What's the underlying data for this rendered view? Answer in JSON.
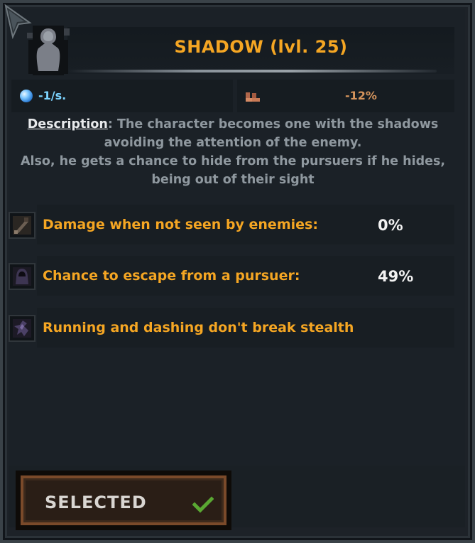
{
  "skill": {
    "title": "SHADOW (lvl. 25)",
    "icon": "shadow-figure-icon"
  },
  "stats": {
    "mana_cost": "-1/s.",
    "mana_icon": "mana-orb-icon",
    "speed_modifier": "-12%",
    "speed_icon": "boots-icon"
  },
  "description": {
    "label": "Description",
    "text_line1": ": The character becomes one with the shadows",
    "text_line2": "avoiding the attention of the enemy.",
    "text_line3": "Also, he gets a chance to hide from the pursuers if he hides,",
    "text_line4": "being out of their sight"
  },
  "effects": [
    {
      "label": "Damage when not seen by enemies:",
      "value": "0%",
      "icon": "dagger-icon"
    },
    {
      "label": "Chance to escape from a pursuer:",
      "value": "49%",
      "icon": "hooded-figure-icon"
    },
    {
      "label": "Running and dashing don't break stealth",
      "value": "",
      "icon": "dash-icon"
    }
  ],
  "button": {
    "label": "SELECTED",
    "icon": "checkmark-icon"
  },
  "colors": {
    "title": "#f5a623",
    "effect_label": "#f5a623",
    "mana": "#7cd4ff",
    "speed": "#d5945c",
    "button_border": "#7a4a2a"
  }
}
